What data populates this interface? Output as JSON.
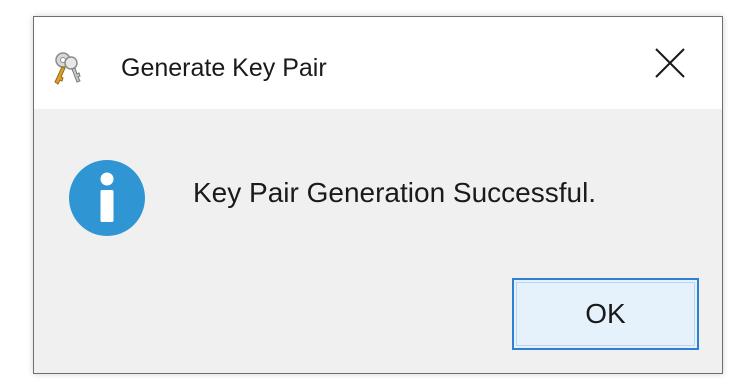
{
  "dialog": {
    "title": "Generate Key Pair",
    "title_icon": "keys-icon",
    "close_icon": "close-icon",
    "message": "Key Pair Generation Successful.",
    "message_icon": "info-icon",
    "ok_label": "OK"
  },
  "colors": {
    "info_blue": "#2f95d3",
    "button_border": "#2f7fd4",
    "button_fill": "#e5f1fb",
    "dialog_body": "#f0f0f0",
    "titlebar": "#ffffff"
  }
}
